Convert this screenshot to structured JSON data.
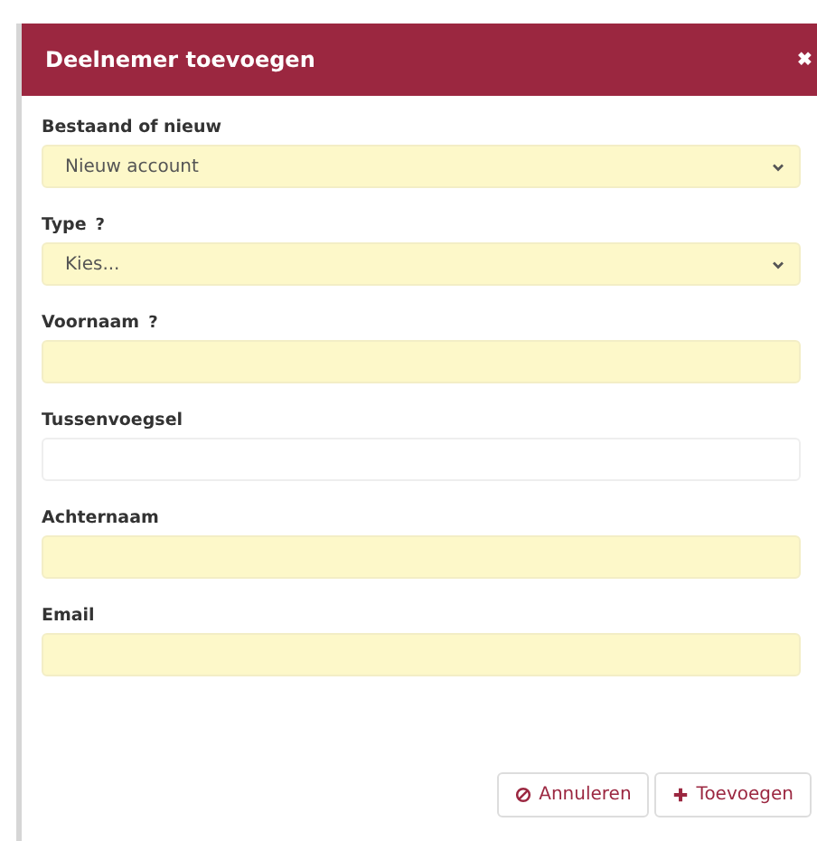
{
  "dialog": {
    "title": "Deelnemer toevoegen",
    "close": "✖"
  },
  "fields": [
    {
      "label": "Bestaand of nieuw",
      "kind": "select",
      "value": "Nieuw account",
      "required": true
    },
    {
      "label": "Type",
      "help": "?",
      "kind": "select",
      "value": "Kies...",
      "required": true
    },
    {
      "label": "Voornaam",
      "help": "?",
      "kind": "text",
      "required": true
    },
    {
      "label": "Tussenvoegsel",
      "kind": "text",
      "required": false
    },
    {
      "label": "Achternaam",
      "kind": "text",
      "required": true
    },
    {
      "label": "Email",
      "kind": "text",
      "required": true
    }
  ],
  "buttons": [
    {
      "label": "Annuleren",
      "kind": "cancel"
    },
    {
      "label": "Toevoegen",
      "kind": "add"
    }
  ]
}
